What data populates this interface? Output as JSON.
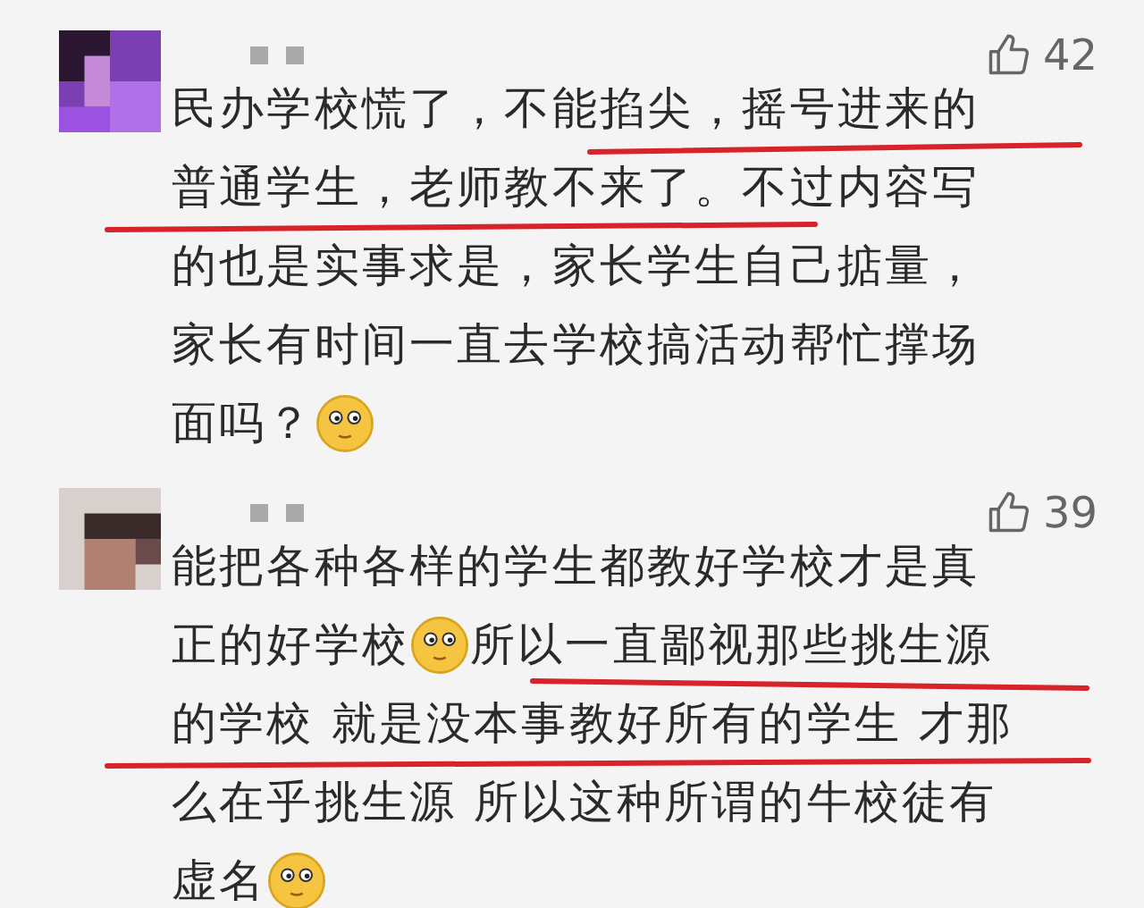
{
  "comments": [
    {
      "likes": "42",
      "lines": [
        [
          {
            "kind": "text",
            "text": "民办学校慌了，不能掐尖，摇号进来的"
          }
        ],
        [
          {
            "kind": "text",
            "text": "普通学生，老师教不来了。不过内容写"
          }
        ],
        [
          {
            "kind": "text",
            "text": "的也是实事求是，家长学生自己掂量，"
          }
        ],
        [
          {
            "kind": "text",
            "text": "家长有时间一直去学校搞活动帮忙撑场"
          }
        ],
        [
          {
            "kind": "text",
            "text": "面吗？"
          },
          {
            "kind": "emoji"
          }
        ]
      ]
    },
    {
      "likes": "39",
      "lines": [
        [
          {
            "kind": "text",
            "text": "能把各种各样的学生都教好学校才是真"
          }
        ],
        [
          {
            "kind": "text",
            "text": "正的好学校"
          },
          {
            "kind": "emoji"
          },
          {
            "kind": "text",
            "text": "所以一直鄙视那些挑生源"
          }
        ],
        [
          {
            "kind": "text",
            "text": "的学校 就是没本事教好所有的学生 才那"
          }
        ],
        [
          {
            "kind": "text",
            "text": "么在乎挑生源 所以这种所谓的牛校徒有"
          }
        ],
        [
          {
            "kind": "text",
            "text": "虚名"
          },
          {
            "kind": "emoji"
          }
        ]
      ]
    }
  ]
}
